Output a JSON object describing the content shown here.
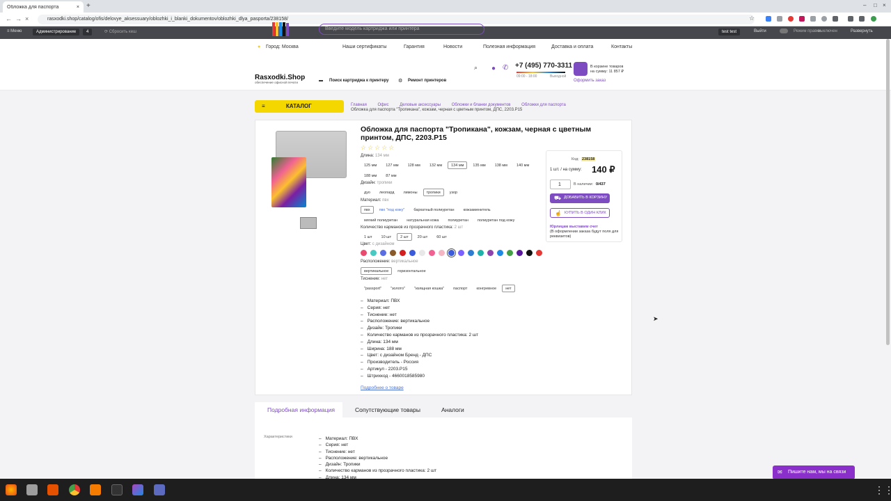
{
  "browser": {
    "tab_title": "Обложка для паспорта",
    "url": "rasxodki.shop/catalog/ofis/delovye_aksessuary/oblozhki_i_blanki_dokumentov/oblozhki_dlya_pasporta/238158/",
    "new_tab": "+",
    "close": "×"
  },
  "admin_bar": {
    "menu": "Меню",
    "admin": "Администрирование",
    "count": "4",
    "reset_cache": "Сбросить кеш",
    "user": "test test",
    "logout": "Выйти",
    "edit_mode": "Режим правки",
    "edit_state": "выключен",
    "expand": "Развернуть"
  },
  "header": {
    "city": "Город: Москва",
    "nav": [
      "Наши сертификаты",
      "Гарантия",
      "Новости",
      "Полезная информация",
      "Доставка и оплата",
      "Контакты"
    ],
    "logo": "Rasxodki.Shop",
    "logo_sub": "обеспечение офисной печати",
    "search_placeholder": "Введите модель картриджа или принтера",
    "cartridge_search": "Поиск картриджа к принтеру",
    "printer_repair": "Ремонт принтеров",
    "phone": "+7 (495) 770-3311",
    "hours": "09:00 - 18:00",
    "weekend": "Выходной",
    "cart_line1": "В корзине товаров",
    "cart_line2": "на сумму: 11 857 ₽",
    "checkout": "Оформить заказ"
  },
  "catalog_button": "КАТАЛОГ",
  "breadcrumbs": [
    "Главная",
    "Офис",
    "Деловые аксессуары",
    "Обложки и бланки документов",
    "Обложки для паспорта"
  ],
  "breadcrumb_current": "Обложка для паспорта \"Тропикана\", кожзам, черная с цветным принтом, ДПС, 2203.P15",
  "product": {
    "title": "Обложка для паспорта \"Тропикана\", кожзам, черная с цветным принтом, ДПС, 2203.P15",
    "rating_stars": "☆☆☆☆☆",
    "length_label": "Длина:",
    "length_value": "134 мм",
    "lengths": [
      "125 мм",
      "127 мм",
      "128 мм",
      "132 мм",
      "134 мм",
      "135 мм",
      "138 мм",
      "140 мм",
      "188 мм",
      "87 мм"
    ],
    "design_label": "Дизайн:",
    "design_value": "тропики",
    "designs": [
      "дуо",
      "леопард",
      "лимоны",
      "тропики",
      "узор"
    ],
    "material_label": "Материал:",
    "material_value": "пвх",
    "materials": [
      "пвх",
      "пвх \"под кожу\"",
      "бархатный полиуретан",
      "кожзаменитель",
      "мягкий полиуретан",
      "натуральная кожа",
      "полиуретан",
      "полиуретан под кожу"
    ],
    "pockets_label": "Количество карманов из прозрачного пластика:",
    "pockets_value": "2 шт",
    "pockets": [
      "1 шт",
      "10 шт",
      "2 шт",
      "20 шт",
      "60 шт"
    ],
    "color_label": "Цвет:",
    "color_value": "с дизайном",
    "swatch_colors": [
      "#e94b6e",
      "#48c9c2",
      "#5b6ee1",
      "#8b5a2b",
      "#d21f1f",
      "#3b5bdb",
      "#e8e8e8",
      "#f06292",
      "#f4b6c2",
      "#3b5bdb",
      "#7b61ff",
      "#2e7dd1",
      "#20b2aa",
      "#8e44ad",
      "#1e88e5",
      "#43a047",
      "#5a189a",
      "#111111",
      "#e53935"
    ],
    "orientation_label": "Расположение:",
    "orientation_value": "вертикальное",
    "orientations": [
      "вертикальное",
      "горизонтальное"
    ],
    "emboss_label": "Тиснение:",
    "emboss_value": "нет",
    "embosses": [
      "\"passport\"",
      "\"золото\"",
      "\"изящная кошка\"",
      "паспорт",
      "конгревное",
      "нет"
    ],
    "properties": [
      "Материал: ПВХ",
      "Серия: нет",
      "Тиснение: нет",
      "Расположение: вертикальное",
      "Дизайн: Тропики",
      "Количество карманов из прозрачного пластика: 2 шт",
      "Длина: 134 мм",
      "Ширина: 188 мм",
      "Цвет: с дизайном Бренд - ДПС",
      "Производитель - Россия",
      "Артикул - 2203.P15",
      "Штрихкод - 4660018585980"
    ],
    "more_link": "Подробнее о товаре"
  },
  "buybox": {
    "code_label": "Код:",
    "code": "238158",
    "unit_label": "1 шт. / на сумму:",
    "price": "140 ₽",
    "qty": "1",
    "stock_label": "В наличии:",
    "stock": "0/437",
    "add_to_cart": "ДОБАВИТЬ В КОРЗИНУ",
    "one_click": "КУПИТЬ В ОДИН КЛИК",
    "legal_title": "Юрлицам выставим счет",
    "legal_note": "(В оформлении заказа будут поля для реквизитов)"
  },
  "tabs": [
    "Подробная информация",
    "Сопутствующие товары",
    "Аналоги"
  ],
  "details_label": "Характеристики",
  "details_props": [
    "Материал: ПВХ",
    "Серия: нет",
    "Тиснение: нет",
    "Расположение: вертикальное",
    "Дизайн: Тропики",
    "Количество карманов из прозрачного пластика: 2 шт",
    "Длина: 134 мм"
  ],
  "chat": "Пишите нам, мы на связи",
  "taskbar_apps": [
    "firefox",
    "files",
    "store",
    "chrome",
    "sublime",
    "terminal",
    "phpstorm",
    "vm"
  ],
  "accent": "#7d4cc0",
  "catalog_color": "#f5d700"
}
